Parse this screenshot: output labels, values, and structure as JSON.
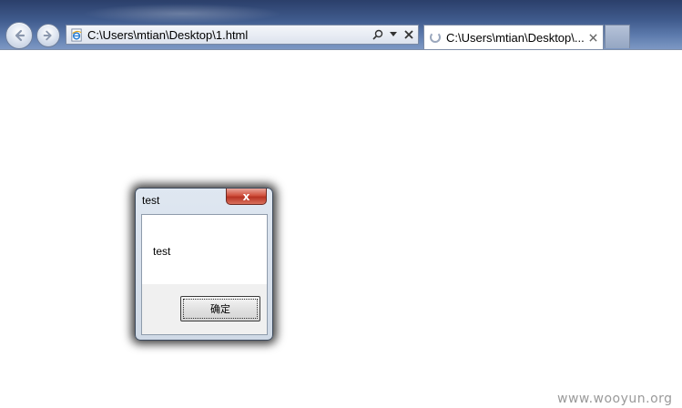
{
  "browser": {
    "address_bar": {
      "url": "C:\\Users\\mtian\\Desktop\\1.html",
      "search_icon": "search-icon",
      "dropdown_icon": "dropdown-icon",
      "stop_icon": "close-icon"
    },
    "tab": {
      "title": "C:\\Users\\mtian\\Desktop\\...",
      "close_icon": "close-icon",
      "status_icon": "loading-spinner-icon"
    },
    "nav": {
      "back_icon": "back-arrow-icon",
      "forward_icon": "forward-arrow-icon"
    }
  },
  "dialog": {
    "title": "test",
    "message": "test",
    "ok_label": "确定",
    "close_glyph": "x"
  },
  "watermark": {
    "text": "www.wooyun.org"
  },
  "colors": {
    "chrome_top": "#2b3f6a",
    "chrome_bottom": "#7d98c4",
    "dialog_close_red": "#c8402d",
    "dialog_frame": "#cfd9e6",
    "watermark": "#9a9a9a"
  }
}
